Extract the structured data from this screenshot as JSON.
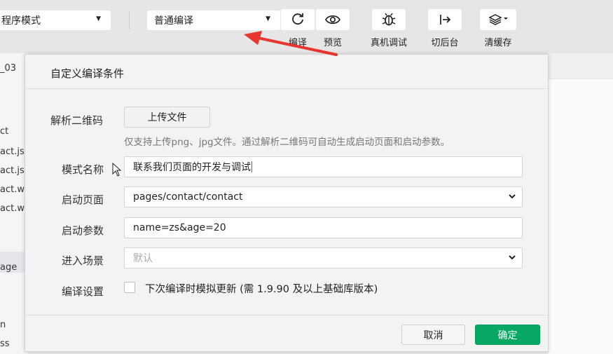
{
  "toolbar": {
    "mode_select": "程序模式",
    "compile_select": "普通编译",
    "buttons": {
      "compile": "编译",
      "preview": "预览",
      "debug": "真机调试",
      "background": "切后台",
      "clear_cache": "清缓存"
    }
  },
  "sidebar": {
    "items": [
      "_03",
      "ct",
      "act.js",
      "act.js",
      "act.w",
      "act.w",
      "age",
      "n",
      "ss"
    ]
  },
  "dialog": {
    "title": "自定义编译条件",
    "qr_label": "解析二维码",
    "upload_label": "上传文件",
    "upload_hint": "仅支持上传png、jpg文件。通过解析二维码可自动生成启动页面和启动参数。",
    "mode_name_label": "模式名称",
    "mode_name_value": "联系我们页面的开发与调试",
    "start_page_label": "启动页面",
    "start_page_value": "pages/contact/contact",
    "start_params_label": "启动参数",
    "start_params_value": "name=zs&age=20",
    "scene_label": "进入场景",
    "scene_placeholder": "默认",
    "compile_settings_label": "编译设置",
    "compile_settings_option": "下次编译时模拟更新 (需 1.9.90 及以上基础库版本)",
    "compile_settings_checked": false,
    "cancel_label": "取消",
    "confirm_label": "确定"
  },
  "colors": {
    "confirm": "#07a863",
    "annotation_arrow": "#e8352e"
  }
}
